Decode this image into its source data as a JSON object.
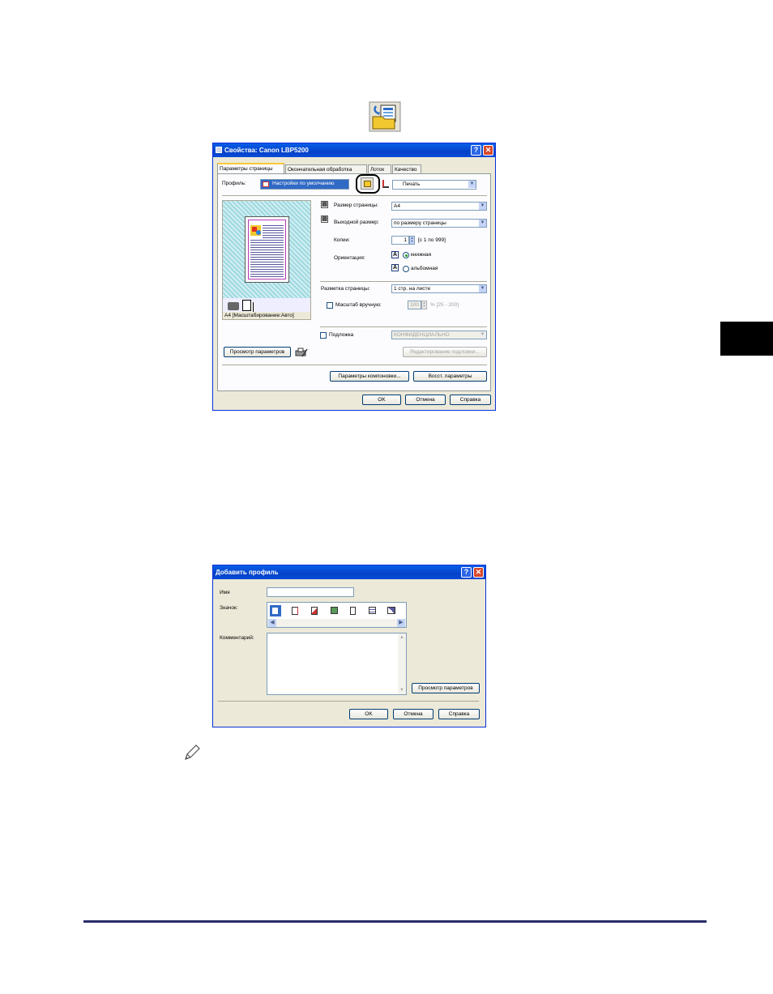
{
  "colors": {
    "accent": "#0a5ee8",
    "rule": "#2b2b6b",
    "thumb_tab": "#000000"
  },
  "toolbar_icon": {
    "icon": "add-profile-icon"
  },
  "props_dialog": {
    "title": "Свойства: Canon LBP5200",
    "tabs": [
      "Параметры страницы",
      "Окончательная обработка",
      "Лоток",
      "Качество"
    ],
    "profile_label": "Профиль:",
    "profile_value": "Настройки по умолчанию",
    "output_method_value": "Печать",
    "page_size_label": "Размер страницы:",
    "page_size_value": "A4",
    "output_size_label": "Выходной размер:",
    "output_size_value": "по размеру страницы",
    "copies_label": "Копии:",
    "copies_value": "1",
    "copies_range": "[с 1 по 999]",
    "orientation_label": "Ориентация:",
    "orientation_portrait": "книжная",
    "orientation_landscape": "альбомная",
    "layout_label": "Разметка страницы:",
    "layout_value": "1 стр. на листе",
    "manual_scale_label": "Масштаб вручную:",
    "manual_scale_value": "100",
    "manual_scale_range": "% [25 - 200]",
    "preview_caption": "A4 [Масштабирование:Авто]",
    "watermark_label": "Подложка",
    "watermark_value": "КОНФИДЕНЦИАЛЬНО",
    "edit_watermark_button": "Редактирование подложки...",
    "view_settings_button": "Просмотр параметров",
    "layout_options_button": "Параметры компоновки...",
    "restore_defaults_button": "Восст. параметры",
    "ok_button": "OK",
    "cancel_button": "Отмена",
    "help_button": "Справка"
  },
  "add_profile_dialog": {
    "title": "Добавить профиль",
    "name_label": "Имя",
    "name_value": "",
    "icon_label": "Значок:",
    "comment_label": "Комментарий:",
    "view_settings_button": "Просмотр параметров",
    "ok_button": "OK",
    "cancel_button": "Отмена",
    "help_button": "Справка"
  },
  "note_icon": "pencil-note-icon"
}
